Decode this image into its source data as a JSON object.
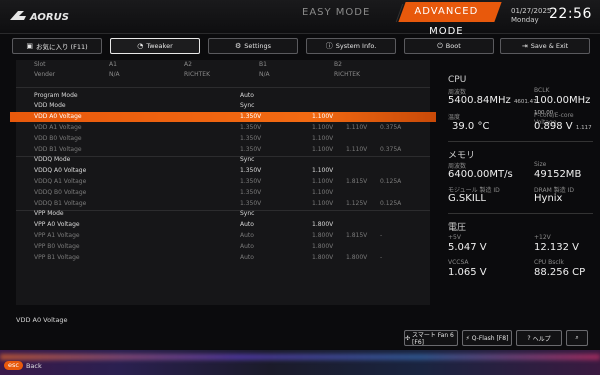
{
  "header": {
    "easy_mode": "EASY MODE",
    "advanced_mode": "ADVANCED MODE",
    "date": "01/27/2025",
    "day": "Monday",
    "time": "22:56"
  },
  "tabs": [
    {
      "label": "お気に入り (F11)",
      "icon": "star-icon"
    },
    {
      "label": "Tweaker",
      "icon": "gauge-icon"
    },
    {
      "label": "Settings",
      "icon": "gear-icon"
    },
    {
      "label": "System Info.",
      "icon": "info-icon"
    },
    {
      "label": "Boot",
      "icon": "power-icon"
    },
    {
      "label": "Save & Exit",
      "icon": "exit-icon"
    }
  ],
  "table": {
    "head1": {
      "name": "Slot",
      "a1": "A1",
      "a2": "A2",
      "b1": "B1",
      "b2": "B2"
    },
    "head2": {
      "name": "Vender",
      "a1": "N/A",
      "a2": "RICHTEK",
      "b1": "N/A",
      "b2": "RICHTEK"
    },
    "rows": [
      {
        "name": "Program Mode",
        "set": "Auto",
        "v1": "",
        "v2": "",
        "v3": ""
      },
      {
        "name": "VDD Mode",
        "set": "Sync",
        "v1": "",
        "v2": "",
        "v3": ""
      },
      {
        "name": "VDD A0 Voltage",
        "set": "1.350V",
        "v1": "1.100V",
        "v2": "",
        "v3": ""
      },
      {
        "name": "VDD A1 Voltage",
        "set": "1.350V",
        "v1": "1.100V",
        "v2": "1.110V",
        "v3": "0.375A"
      },
      {
        "name": "VDD B0 Voltage",
        "set": "1.350V",
        "v1": "1.100V",
        "v2": "",
        "v3": ""
      },
      {
        "name": "VDD B1 Voltage",
        "set": "1.350V",
        "v1": "1.100V",
        "v2": "1.110V",
        "v3": "0.375A"
      },
      {
        "name": "VDDQ Mode",
        "set": "Sync",
        "v1": "",
        "v2": "",
        "v3": ""
      },
      {
        "name": "VDDQ A0 Voltage",
        "set": "1.350V",
        "v1": "1.100V",
        "v2": "",
        "v3": ""
      },
      {
        "name": "VDDQ A1 Voltage",
        "set": "1.350V",
        "v1": "1.100V",
        "v2": "1.815V",
        "v3": "0.125A"
      },
      {
        "name": "VDDQ B0 Voltage",
        "set": "1.350V",
        "v1": "1.100V",
        "v2": "",
        "v3": ""
      },
      {
        "name": "VDDQ B1 Voltage",
        "set": "1.350V",
        "v1": "1.100V",
        "v2": "1.125V",
        "v3": "0.125A"
      },
      {
        "name": "VPP Mode",
        "set": "Sync",
        "v1": "",
        "v2": "",
        "v3": ""
      },
      {
        "name": "VPP A0 Voltage",
        "set": "Auto",
        "v1": "1.800V",
        "v2": "",
        "v3": ""
      },
      {
        "name": "VPP A1 Voltage",
        "set": "Auto",
        "v1": "1.800V",
        "v2": "1.815V",
        "v3": "-"
      },
      {
        "name": "VPP B0 Voltage",
        "set": "Auto",
        "v1": "1.800V",
        "v2": "",
        "v3": ""
      },
      {
        "name": "VPP B1 Voltage",
        "set": "Auto",
        "v1": "1.800V",
        "v2": "1.800V",
        "v3": "-"
      }
    ]
  },
  "info": {
    "cpu": {
      "title": "CPU",
      "freq_label": "周波数",
      "freq": "5400.84MHz",
      "freq_sub": "4601.47",
      "bclk_label": "BCLK",
      "bclk": "100.00MHz",
      "bclk_sub": "100.00",
      "temp_label": "温度",
      "temp": "39.0 °C",
      "vcore_label": "P-core/E-core Voltage",
      "vcore": "0.898 V",
      "vcore_sub": "1.117"
    },
    "mem": {
      "title": "メモリ",
      "freq_label": "周波数",
      "freq": "6400.00MT/s",
      "size_label": "Size",
      "size": "49152MB",
      "maker_label": "モジュール 製造 ID",
      "maker": "G.SKILL",
      "dram_label": "DRAM 製造 ID",
      "dram": "Hynix"
    },
    "volt": {
      "title": "電圧",
      "p5_label": "+5V",
      "p5": "5.047 V",
      "p12_label": "+12V",
      "p12": "12.132 V",
      "vccsa_label": "VCCSA",
      "vccsa": "1.065 V",
      "bclk_label": "CPU Bsclk",
      "bclk": "88.256 CP"
    }
  },
  "footer": {
    "description": "VDD A0 Voltage",
    "smart_fan": "スマート Fan 6 [F6]",
    "qflash": "Q-Flash [F8]",
    "help": "ヘルプ",
    "esc_key": "esc",
    "esc_label": "Back"
  },
  "colors": {
    "accent": "#e8590c"
  }
}
